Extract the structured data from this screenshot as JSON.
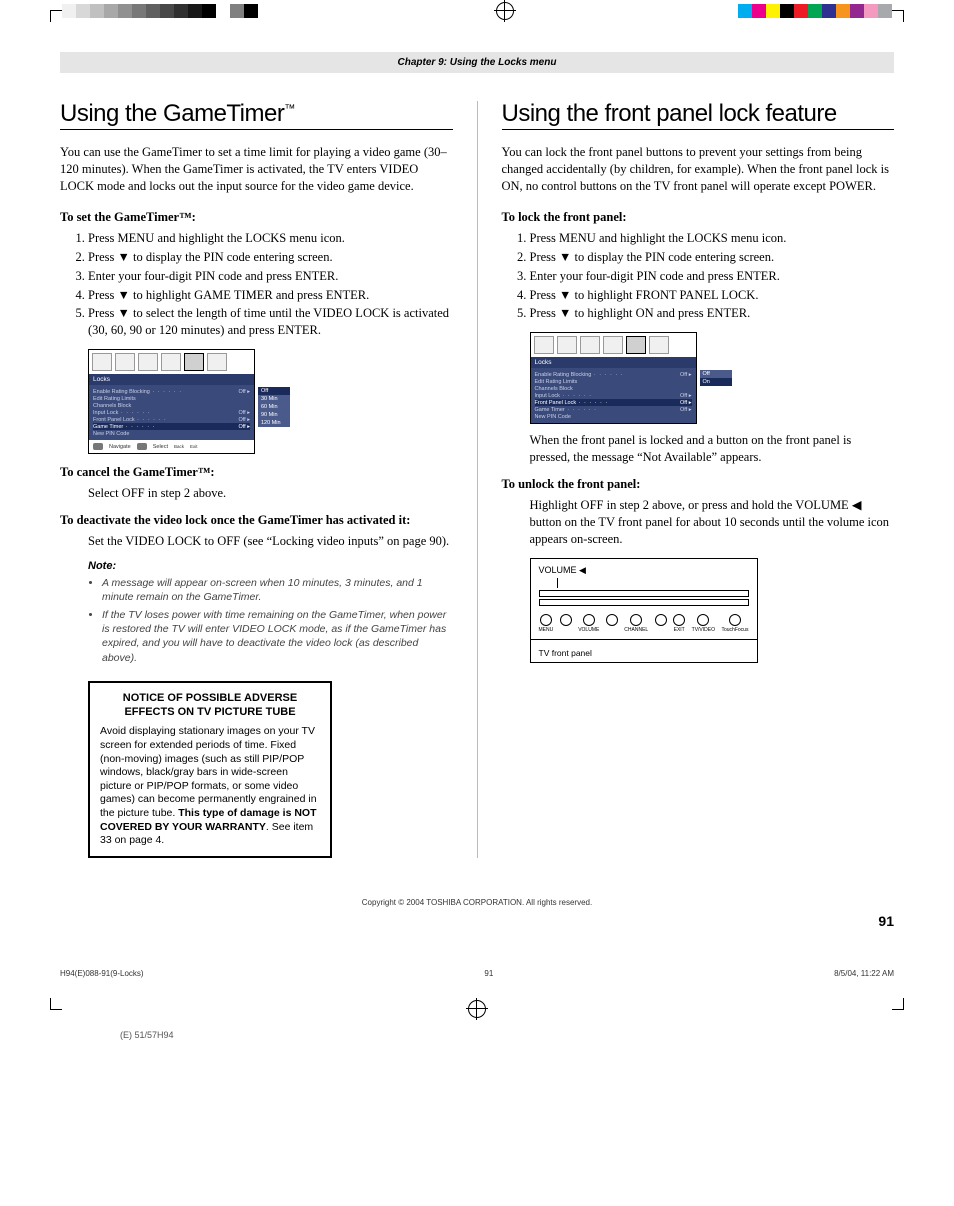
{
  "print": {
    "gray_bar": [
      "#f0f0f0",
      "#d8d8d8",
      "#c0c0c0",
      "#a8a8a8",
      "#909090",
      "#787878",
      "#606060",
      "#484848",
      "#303030",
      "#181818",
      "#000000",
      "#ffffff",
      "#808080",
      "#000000",
      "#ffffff"
    ],
    "color_bar": [
      "#00aeef",
      "#ec008c",
      "#fff200",
      "#000000",
      "#ed1c24",
      "#00a651",
      "#2e3192",
      "#f7941d",
      "#92278f",
      "#f49ac1",
      "#a7a9ac"
    ]
  },
  "header": "Chapter 9: Using the Locks menu",
  "left": {
    "title": "Using the GameTimer",
    "title_tm": "™",
    "intro": "You can use the GameTimer to set a time limit for playing a video game (30–120 minutes). When the GameTimer is activated, the TV enters VIDEO LOCK mode and locks out the input source for the video game device.",
    "sub1": "To set the GameTimer™:",
    "steps1": [
      "Press MENU and highlight the LOCKS menu icon.",
      "Press ▼ to display the PIN code entering screen.",
      "Enter your four-digit PIN code and press ENTER.",
      "Press ▼ to highlight GAME TIMER and press ENTER.",
      "Press ▼ to select the length of time until the VIDEO LOCK is activated (30, 60, 90 or 120 minutes) and press ENTER."
    ],
    "menu": {
      "title": "Locks",
      "rows": [
        {
          "l": "Enable Rating Blocking",
          "r": "Off",
          "arr": true
        },
        {
          "l": "Edit Rating Limits",
          "r": "",
          "arr": false
        },
        {
          "l": "Channels Block",
          "r": "",
          "arr": false
        },
        {
          "l": "Input Lock",
          "r": "Off",
          "arr": true
        },
        {
          "l": "Front Panel Lock",
          "r": "Off",
          "arr": true
        },
        {
          "l": "Game Timer",
          "r": "Off",
          "arr": true,
          "hl": true
        },
        {
          "l": "New PIN Code",
          "r": "",
          "arr": false
        }
      ],
      "side": [
        "Off",
        "30 Min",
        "60 Min",
        "90 Min",
        "120 Min"
      ],
      "side_hl": 0,
      "foot": [
        "Navigate",
        "Select",
        "Back",
        "Exit"
      ]
    },
    "sub2": "To cancel the GameTimer™:",
    "cancel": "Select OFF in step 2 above.",
    "sub3": "To deactivate the video lock once the GameTimer has activated it:",
    "deact": "Set the VIDEO LOCK to OFF (see “Locking video inputs” on page 90).",
    "note_head": "Note:",
    "notes": [
      "A message will appear on-screen when 10 minutes, 3 minutes, and 1 minute remain on the GameTimer.",
      "If the TV loses power with time remaining on the GameTimer, when power is restored the TV will enter VIDEO LOCK mode, as if the GameTimer has expired, and you will have to deactivate the video lock (as described above)."
    ],
    "notice_title": "NOTICE OF POSSIBLE ADVERSE EFFECTS ON TV PICTURE TUBE",
    "notice_body_1": "Avoid displaying stationary images on your TV screen for extended periods of time. Fixed (non-moving) images (such as still PIP/POP windows, black/gray bars in wide-screen picture or PIP/POP formats, or some video games) can become permanently engrained in the picture tube. ",
    "notice_body_bold": "This type of damage is NOT COVERED BY YOUR WARRANTY",
    "notice_body_2": ". See item 33 on page 4."
  },
  "right": {
    "title": "Using the front panel lock feature",
    "intro": "You can lock the front panel buttons to prevent your settings from being changed accidentally (by children, for example). When the front panel lock is ON, no control buttons on the TV front panel will operate except POWER.",
    "sub1": "To lock the front panel:",
    "steps1": [
      "Press MENU and highlight the LOCKS menu icon.",
      "Press ▼ to display the PIN code entering screen.",
      "Enter your four-digit PIN code and press ENTER.",
      "Press ▼ to highlight FRONT PANEL LOCK.",
      "Press ▼ to highlight ON and press ENTER."
    ],
    "menu": {
      "title": "Locks",
      "rows": [
        {
          "l": "Enable Rating Blocking",
          "r": "Off",
          "arr": true
        },
        {
          "l": "Edit Rating Limits",
          "r": "",
          "arr": false
        },
        {
          "l": "Channels Block",
          "r": "",
          "arr": false
        },
        {
          "l": "Input Lock",
          "r": "Off",
          "arr": true
        },
        {
          "l": "Front Panel Lock",
          "r": "Off",
          "arr": true,
          "hl": true
        },
        {
          "l": "Game Timer",
          "r": "Off",
          "arr": true
        },
        {
          "l": "New PIN Code",
          "r": "",
          "arr": false
        }
      ],
      "side": [
        "Off",
        "On"
      ],
      "side_hl": 1
    },
    "after_menu": "When the front panel is locked and a button on the front panel is pressed, the message “Not Available” appears.",
    "sub2": "To unlock the front panel:",
    "unlock": "Highlight OFF in step 2 above, or press and hold the VOLUME ◀ button on the TV front panel for about 10 seconds until the volume icon appears on-screen.",
    "panel": {
      "label": "VOLUME ◀",
      "buttons": [
        "MENU",
        "",
        "VOLUME",
        "",
        "CHANNEL",
        "",
        "EXIT",
        "TV/VIDEO",
        "TouchFocus"
      ],
      "foot": "TV front panel"
    }
  },
  "copyright": "Copyright © 2004 TOSHIBA CORPORATION. All rights reserved.",
  "page_num": "91",
  "slug": {
    "file": "H94(E)088-91(9-Locks)",
    "page": "91",
    "date": "8/5/04, 11:22 AM"
  },
  "file_tag": "(E) 51/57H94"
}
